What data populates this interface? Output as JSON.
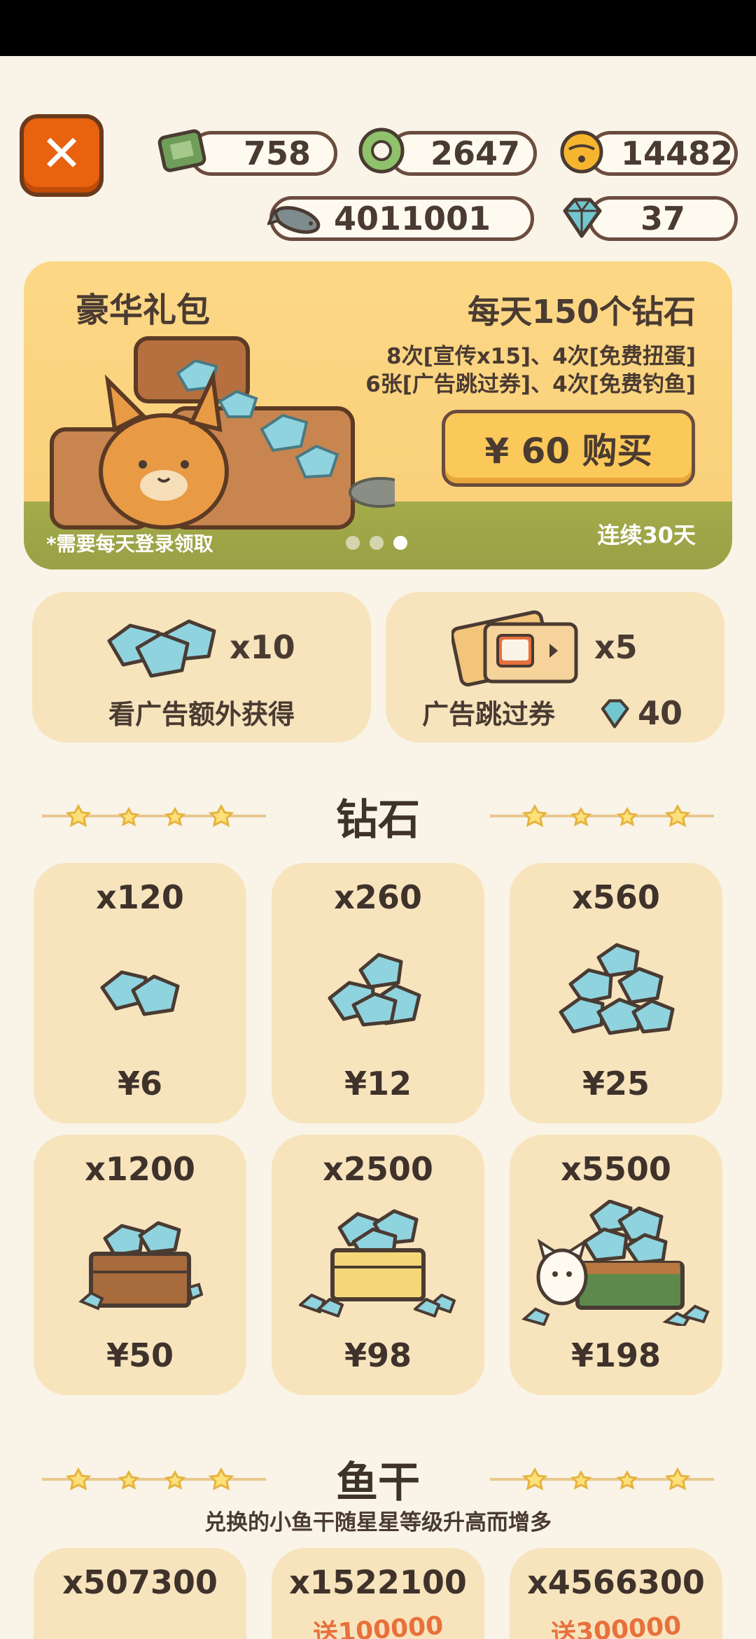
{
  "currencies": {
    "tickets": "758",
    "coins": "2647",
    "bells": "14482",
    "fish": "4011001",
    "diamonds": "37"
  },
  "banner": {
    "title": "豪华礼包",
    "headline": "每天150个钻石",
    "line1": "8次[宣传x15]、4次[免费扭蛋]",
    "line2": "6张[广告跳过券]、4次[免费钓鱼]",
    "buy_label": "¥ 60 购买",
    "note": "*需要每天登录领取",
    "days": "连续30天"
  },
  "promo_ad": {
    "qty": "x10",
    "label": "看广告额外获得"
  },
  "promo_skip": {
    "qty": "x5",
    "label": "广告跳过券",
    "price": "40"
  },
  "diamond_section": {
    "title": "钻石"
  },
  "diamond_packs": [
    {
      "amount": "x120",
      "price": "¥6"
    },
    {
      "amount": "x260",
      "price": "¥12"
    },
    {
      "amount": "x560",
      "price": "¥25"
    },
    {
      "amount": "x1200",
      "price": "¥50"
    },
    {
      "amount": "x2500",
      "price": "¥98"
    },
    {
      "amount": "x5500",
      "price": "¥198"
    }
  ],
  "fish_section": {
    "title": "鱼干",
    "subtitle": "兑换的小鱼干随星星等级升高而增多"
  },
  "fish_packs": [
    {
      "amount": "x507300",
      "bonus": ""
    },
    {
      "amount": "x1522100",
      "bonus": "送100000"
    },
    {
      "amount": "x4566300",
      "bonus": "送300000"
    }
  ]
}
